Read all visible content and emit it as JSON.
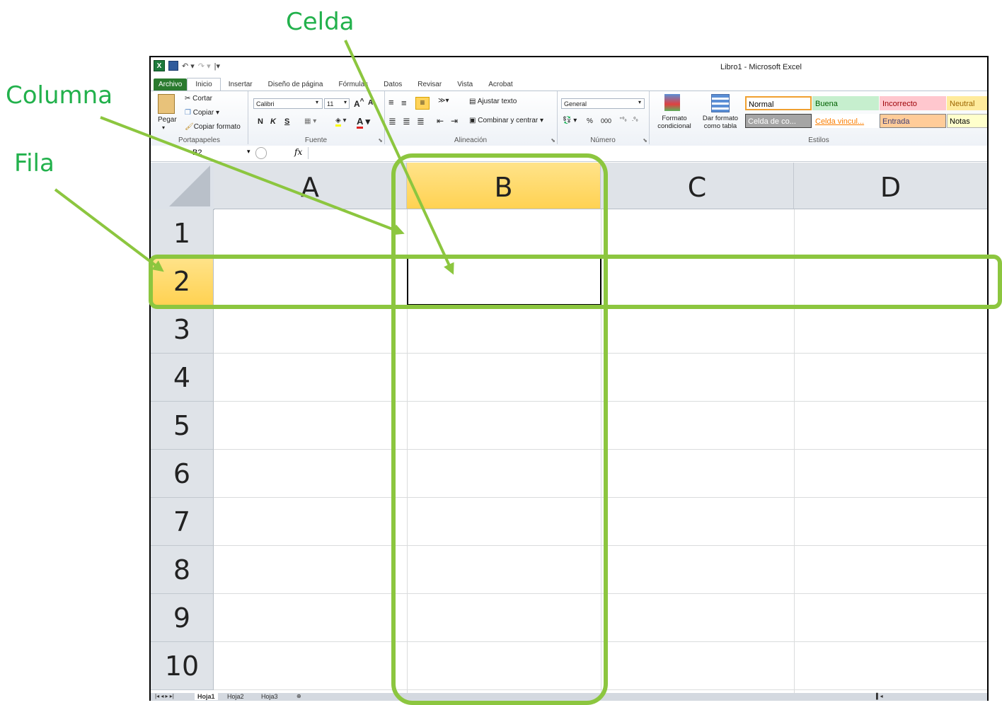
{
  "annotations": {
    "celda": "Celda",
    "columna": "Columna",
    "fila": "Fila"
  },
  "window": {
    "title": "Libro1  -  Microsoft Excel",
    "excel_icon": "X",
    "tabs": [
      "Archivo",
      "Inicio",
      "Insertar",
      "Diseño de página",
      "Fórmulas",
      "Datos",
      "Revisar",
      "Vista",
      "Acrobat"
    ]
  },
  "ribbon": {
    "clipboard": {
      "paste": "Pegar",
      "cut": "Cortar",
      "copy": "Copiar",
      "format_painter": "Copiar formato",
      "group": "Portapapeles"
    },
    "font": {
      "name": "Calibri",
      "size": "11",
      "bold": "N",
      "italic": "K",
      "underline": "S",
      "group": "Fuente"
    },
    "alignment": {
      "wrap": "Ajustar texto",
      "merge": "Combinar y centrar",
      "group": "Alineación"
    },
    "number": {
      "format": "General",
      "percent": "%",
      "thousands": "000",
      "group": "Número"
    },
    "styles": {
      "conditional": "Formato condicional",
      "as_table": "Dar formato como tabla",
      "group": "Estilos",
      "cells": [
        {
          "label": "Normal",
          "bg": "#ffffff",
          "fg": "#000000",
          "border": "#f0a030"
        },
        {
          "label": "Buena",
          "bg": "#c6efce",
          "fg": "#006100",
          "border": "#c6efce"
        },
        {
          "label": "Incorrecto",
          "bg": "#ffc7ce",
          "fg": "#9c0006",
          "border": "#ffc7ce"
        },
        {
          "label": "Neutral",
          "bg": "#ffeb9c",
          "fg": "#9c6500",
          "border": "#ffeb9c"
        },
        {
          "label": "Celda de co...",
          "bg": "#a5a5a5",
          "fg": "#ffffff",
          "border": "#3f3f3f"
        },
        {
          "label": "Celda vincul...",
          "bg": "#ffffff",
          "fg": "#fa7d00",
          "border": "#ffffff"
        },
        {
          "label": "Entrada",
          "bg": "#ffcc99",
          "fg": "#3f3f76",
          "border": "#7f7f7f"
        },
        {
          "label": "Notas",
          "bg": "#ffffcc",
          "fg": "#000000",
          "border": "#b2b2b2"
        }
      ]
    }
  },
  "formula_bar": {
    "name_box": "B2",
    "fx": "fx",
    "value": ""
  },
  "grid": {
    "columns": [
      "A",
      "B",
      "C",
      "D"
    ],
    "rows": [
      "1",
      "2",
      "3",
      "4",
      "5",
      "6",
      "7",
      "8",
      "9",
      "10"
    ],
    "selected_column": "B",
    "selected_row": "2"
  },
  "sheets": [
    "Hoja1",
    "Hoja2",
    "Hoja3"
  ],
  "colors": {
    "annotation": "#22b14c",
    "highlight": "#8cc63f",
    "selected_header": "#ffd252"
  }
}
